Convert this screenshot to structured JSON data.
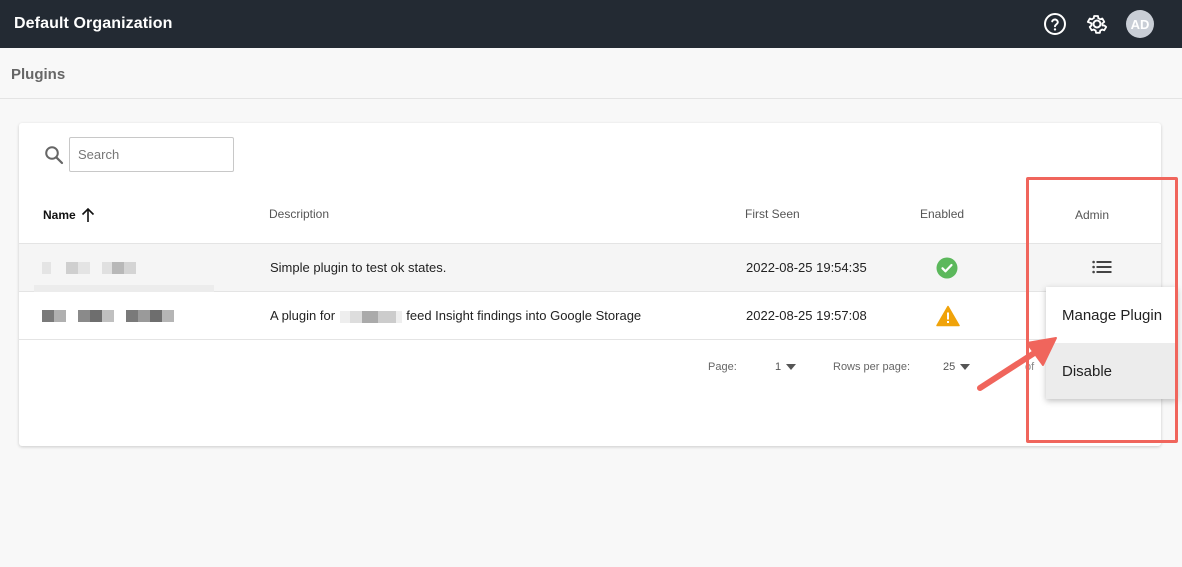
{
  "header": {
    "org_name": "Default Organization",
    "avatar_initials": "AD"
  },
  "page": {
    "title": "Plugins"
  },
  "search": {
    "placeholder": "Search",
    "value": ""
  },
  "table": {
    "columns": {
      "name": "Name",
      "description": "Description",
      "first_seen": "First Seen",
      "enabled": "Enabled",
      "admin": "Admin"
    },
    "rows": [
      {
        "description": "Simple plugin to test ok states.",
        "first_seen": "2022-08-25 19:54:35",
        "status_icon": "check-circle-icon"
      },
      {
        "description_prefix": "A plugin for ",
        "description_suffix": " feed Insight findings into Google Storage",
        "first_seen": "2022-08-25 19:57:08",
        "status_icon": "warning-triangle-icon"
      }
    ]
  },
  "pagination": {
    "page_label": "Page:",
    "page_value": "1",
    "rows_label": "Rows per page:",
    "rows_value": "25",
    "of_label": "of"
  },
  "menu": {
    "manage_label": "Manage Plugin",
    "disable_label": "Disable"
  },
  "colors": {
    "topbar": "#232a33",
    "success": "#5cb85c",
    "warning": "#f0a30a",
    "annotation": "#f0655c"
  }
}
